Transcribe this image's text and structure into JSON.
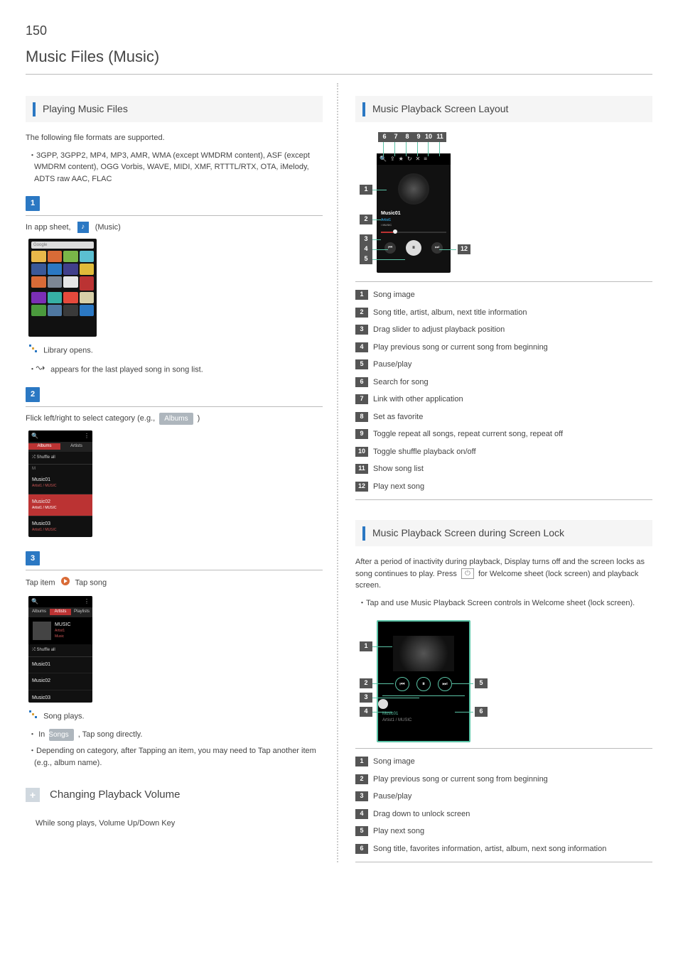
{
  "page_number": "150",
  "page_title": "Music Files (Music)",
  "left": {
    "section1_title": "Playing Music Files",
    "intro": "The following file formats are supported.",
    "formats_bullet": "3GPP, 3GPP2, MP4, MP3, AMR, WMA (except WMDRM content), ASF (except WMDRM content), OGG Vorbis, WAVE, MIDI, XMF, RTTTL/RTX, OTA, iMelody, ADTS raw AAC, FLAC",
    "step1_line_a": "In app sheet, ",
    "step1_line_b": " (Music)",
    "step1_result": "  Library opens.",
    "step1_bullet": "appears for the last played song in song list.",
    "sc1_search": "Google",
    "step2_text_a": "Flick left/right to select category (e.g., ",
    "step2_text_b": " )",
    "albums_tag": "Albums",
    "sc2_tab_albums": "Albums",
    "sc2_tab_artists": "Artists",
    "sc2_shuffle": "⤮ Shuffle all",
    "sc2_letter": "M",
    "sc2_row1": "Music01",
    "sc2_row1_sub": "Artist1 / MUSIC",
    "sc2_row2": "Music02",
    "sc2_row2_sub": "Artist1 / MUSIC",
    "sc2_row3": "Music03",
    "sc2_row3_sub": "Artist1 / MUSIC",
    "step3_text_a": "Tap item ",
    "step3_text_b": " Tap song",
    "sc3_tab_albums": "Albums",
    "sc3_tab_artists": "Artists",
    "sc3_tab_playlists": "Playlists",
    "sc3_title": "MUSIC",
    "sc3_sub1": "Artist1",
    "sc3_sub2": "Music",
    "sc3_shuffle": "⤮ Shuffle all",
    "sc3_row1": "Music01",
    "sc3_row2": "Music02",
    "sc3_row3": "Music03",
    "step3_result": "  Song plays.",
    "songs_tag": "Songs",
    "step3_bullet1_a": "In ",
    "step3_bullet1_b": " , Tap song directly.",
    "step3_bullet2": "Depending on category, after Tapping an item, you may need to Tap another item (e.g., album name).",
    "plus_title": "Changing Playback Volume",
    "plus_body": "While song plays, Volume Up/Down Key"
  },
  "right": {
    "section1_title": "Music Playback Screen Layout",
    "dg1_song": "Music01",
    "dg1_artist": "Artist1",
    "dg1_album": "/ MUSIC",
    "legend1": {
      "1": "Song image",
      "2": "Song title, artist, album, next title information",
      "3": "Drag slider to adjust playback position",
      "4": "Play previous song or current song from beginning",
      "5": "Pause/play",
      "6": "Search for song",
      "7": "Link with other application",
      "8": "Set as favorite",
      "9": "Toggle repeat all songs, repeat current song, repeat off",
      "10": "Toggle shuffle playback on/off",
      "11": "Show song list",
      "12": "Play next song"
    },
    "section2_title": "Music Playback Screen during Screen Lock",
    "section2_body_a": "After a period of inactivity during playback, Display turns off and the screen locks as song continues to play. Press ",
    "section2_body_b": " for Welcome sheet (lock screen) and playback screen.",
    "section2_bullet": "Tap and use Music Playback Screen controls in Welcome sheet (lock screen).",
    "dg2_song": "Music01",
    "dg2_artist_album": "Artist1 / MUSIC",
    "legend2": {
      "1": "Song image",
      "2": "Play previous song or current song from beginning",
      "3": "Pause/play",
      "4": "Drag down to unlock screen",
      "5": "Play next song",
      "6": "Song title, favorites information, artist, album, next song information"
    }
  }
}
